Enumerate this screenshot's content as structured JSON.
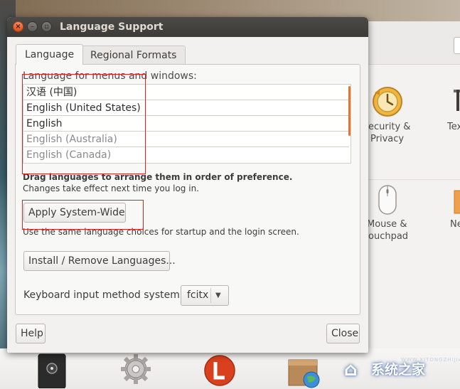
{
  "window": {
    "title": "Language Support"
  },
  "tabs": [
    {
      "label": "Language",
      "active": true
    },
    {
      "label": "Regional Formats",
      "active": false
    }
  ],
  "language_panel": {
    "section_label": "Language for menus and windows:",
    "languages": [
      {
        "label": "汉语 (中国)",
        "enabled": true
      },
      {
        "label": "English (United States)",
        "enabled": true
      },
      {
        "label": "English",
        "enabled": true
      },
      {
        "label": "English (Australia)",
        "enabled": false
      },
      {
        "label": "English (Canada)",
        "enabled": false
      }
    ],
    "hint_bold": "Drag languages to arrange them in order of preference.",
    "hint": "Changes take effect next time you log in.",
    "apply_button": "Apply System-Wide",
    "apply_hint": "Use the same language choices for startup and the login screen.",
    "install_button": "Install / Remove Languages...",
    "keyboard_label": "Keyboard input method system:",
    "keyboard_value": "fcitx"
  },
  "footer": {
    "help_button": "Help",
    "close_button": "Close"
  },
  "background_settings": {
    "items": [
      {
        "label_line1": "ecurity &",
        "label_line2": "Privacy"
      },
      {
        "label_line1": "Tex",
        "label_line2": ""
      },
      {
        "label_line1": "Mouse &",
        "label_line2": "ouchpad"
      },
      {
        "label_line1": "Ne",
        "label_line2": ""
      }
    ]
  },
  "watermark": {
    "text": "系统之家",
    "url": "WWW.XITONGZHIJIA.NET"
  },
  "colors": {
    "titlebar": "#3c3b37",
    "accent_scroll": "#e0772e",
    "annotation": "#e02020",
    "close_button": "#e0501f"
  }
}
